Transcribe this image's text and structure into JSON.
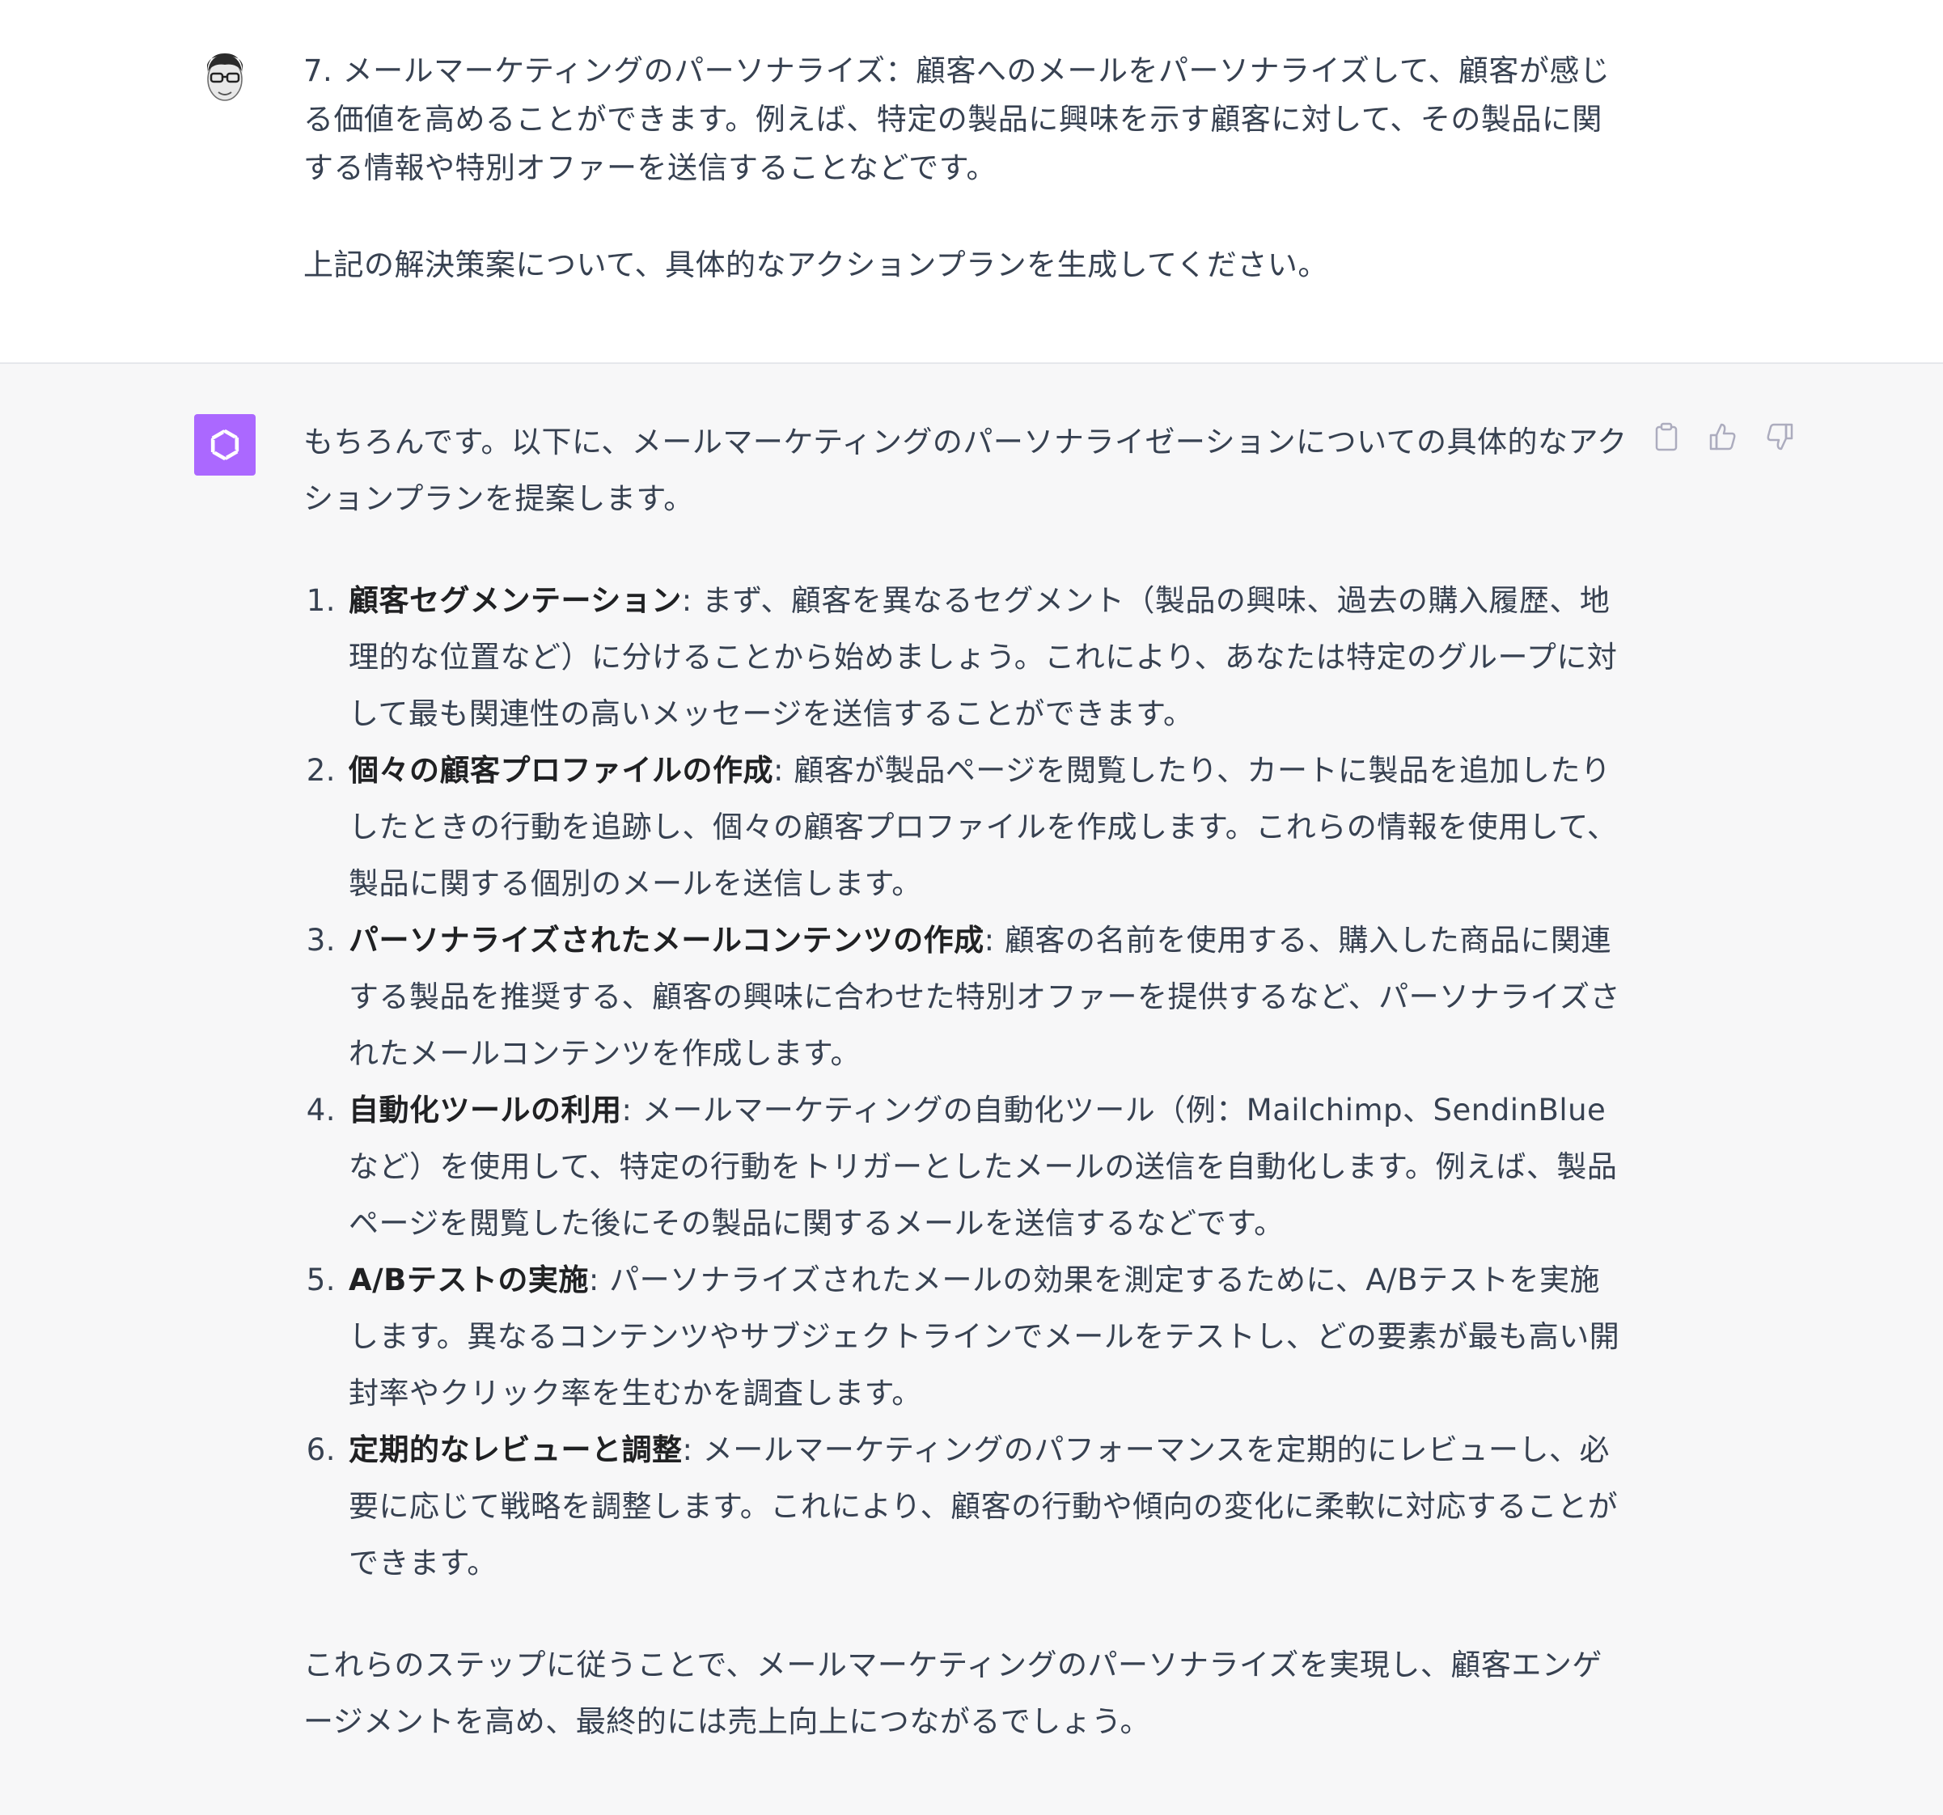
{
  "user": {
    "avatar_icon": "user-avatar-icon",
    "paragraphs": [
      "7. メールマーケティングのパーソナライズ：顧客へのメールをパーソナライズして、顧客が感じる価値を高めることができます。例えば、特定の製品に興味を示す顧客に対して、その製品に関する情報や特別オファーを送信することなどです。",
      "上記の解決策案について、具体的なアクションプランを生成してください。"
    ]
  },
  "assistant": {
    "avatar_icon": "openai-logo-icon",
    "avatar_color": "#ab68ff",
    "intro": "もちろんです。以下に、メールマーケティングのパーソナライゼーションについての具体的なアクションプランを提案します。",
    "steps": [
      {
        "num": "1.",
        "title": "顧客セグメンテーション",
        "text": ": まず、顧客を異なるセグメント（製品の興味、過去の購入履歴、地理的な位置など）に分けることから始めましょう。これにより、あなたは特定のグループに対して最も関連性の高いメッセージを送信することができます。"
      },
      {
        "num": "2.",
        "title": "個々の顧客プロファイルの作成",
        "text": ": 顧客が製品ページを閲覧したり、カートに製品を追加したりしたときの行動を追跡し、個々の顧客プロファイルを作成します。これらの情報を使用して、製品に関する個別のメールを送信します。"
      },
      {
        "num": "3.",
        "title": "パーソナライズされたメールコンテンツの作成",
        "text": ": 顧客の名前を使用する、購入した商品に関連する製品を推奨する、顧客の興味に合わせた特別オファーを提供するなど、パーソナライズされたメールコンテンツを作成します。"
      },
      {
        "num": "4.",
        "title": "自動化ツールの利用",
        "text": ": メールマーケティングの自動化ツール（例：Mailchimp、SendinBlueなど）を使用して、特定の行動をトリガーとしたメールの送信を自動化します。例えば、製品ページを閲覧した後にその製品に関するメールを送信するなどです。"
      },
      {
        "num": "5.",
        "title": "A/Bテストの実施",
        "text": ": パーソナライズされたメールの効果を測定するために、A/Bテストを実施します。異なるコンテンツやサブジェクトラインでメールをテストし、どの要素が最も高い開封率やクリック率を生むかを調査します。"
      },
      {
        "num": "6.",
        "title": "定期的なレビューと調整",
        "text": ": メールマーケティングのパフォーマンスを定期的にレビューし、必要に応じて戦略を調整します。これにより、顧客の行動や傾向の変化に柔軟に対応することができます。"
      }
    ],
    "outro": "これらのステップに従うことで、メールマーケティングのパーソナライズを実現し、顧客エンゲージメントを高め、最終的には売上向上につながるでしょう。",
    "actions": [
      {
        "icon": "clipboard-icon"
      },
      {
        "icon": "thumbs-up-icon"
      },
      {
        "icon": "thumbs-down-icon"
      }
    ]
  }
}
